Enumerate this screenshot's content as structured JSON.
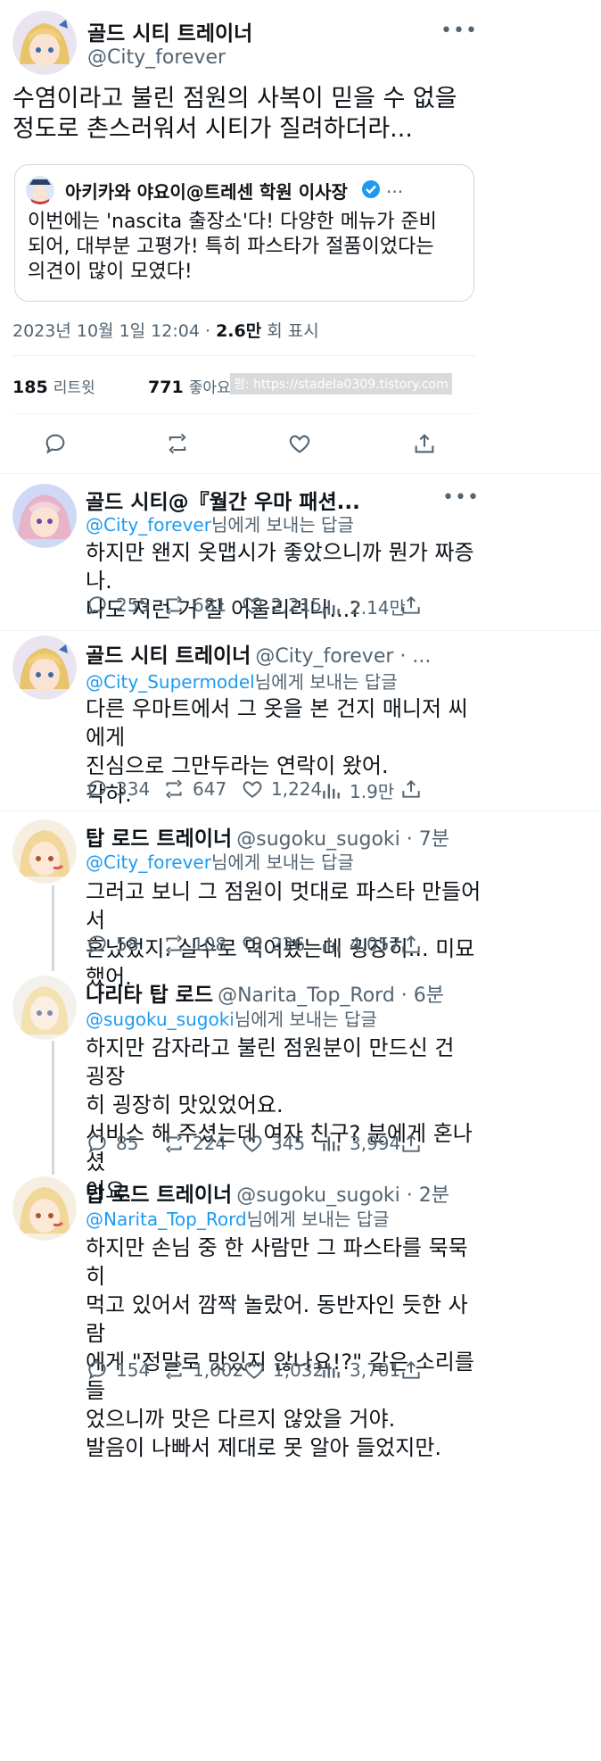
{
  "main_tweet": {
    "name": "골드 시티 트레이너",
    "handle": "@City_forever",
    "text": "수염이라고 불린 점원의 사복이 믿을 수 없을\n정도로 촌스러워서 시티가 질려하더라...",
    "quote": {
      "name": "아키카와 야요이@트레센 학원 이사장",
      "text": "이번에는 'nascita 출장소'다! 다양한 메뉴가 준비\n되어, 대부분 고평가! 특히 파스타가 절품이었다는\n의견이 많이 모였다!"
    },
    "date": "2023년 10월 1일  12:04",
    "views": "2.6만",
    "views_label": "회 표시",
    "retweets": "185",
    "retweets_label": "리트윗",
    "likes": "771",
    "likes_label": "좋아요",
    "watermark": "펌: https://stadela0309.tistory.com"
  },
  "replies": [
    {
      "name": "골드 시티@『월간 우마 패션...",
      "handle": "",
      "time": "",
      "reply_handle": "@City_forever",
      "reply_suffix": "님에게 보내는 답글",
      "text": "하지만 왠지 옷맵시가 좋았으니까 뭔가 짜증나.\n나도 저런 거 잘 어울리려나...?",
      "comments": "255",
      "retweets": "681",
      "likes": "2,215",
      "views": "2.14만"
    },
    {
      "name": "골드 시티 트레이너",
      "handle": "@City_forever · ...",
      "time": "",
      "reply_handle": "@City_Supermodel",
      "reply_suffix": "님에게 보내는 답글",
      "text": "다른 우마트에서 그 옷을 본 건지 매니저 씨에게\n진심으로 그만두라는 연락이 왔어.\n각하.",
      "comments": "334",
      "retweets": "647",
      "likes": "1,224",
      "views": "1.9만"
    },
    {
      "name": "탑 로드 트레이너",
      "handle": "@sugoku_sugoki · 7분",
      "time": "",
      "reply_handle": "@City_forever",
      "reply_suffix": "님에게 보내는 답글",
      "text": "그러고 보니 그 점원이 멋대로 파스타 만들어서\n혼났었지. 실수로 먹어봤는데 굉장히... 미묘했어.",
      "comments": "58",
      "retweets": "108",
      "likes": "226",
      "views": "4,057"
    },
    {
      "name": "나리타 탑 로드",
      "handle": "@Narita_Top_Rord · 6분",
      "time": "",
      "reply_handle": "@sugoku_sugoki",
      "reply_suffix": "님에게 보내는 답글",
      "text": "하지만 감자라고 불린 점원분이 만드신 건 굉장\n히 굉장히 맛있었어요.\n서비스 해 주셨는데 여자 친구? 분에게 혼나셨\n어요.",
      "comments": "85",
      "retweets": "224",
      "likes": "345",
      "views": "3,994"
    },
    {
      "name": "탑 로드 트레이너",
      "handle": "@sugoku_sugoki · 2분",
      "time": "",
      "reply_handle": "@Narita_Top_Rord",
      "reply_suffix": "님에게 보내는 답글",
      "text": "하지만 손님 중 한 사람만 그 파스타를 묵묵히\n먹고 있어서 깜짝 놀랐어. 동반자인 듯한 사람\n에게 \"정말로 맛있지 않나요!?\" 같은 소리를 들\n었으니까 맛은 다르지 않았을 거야.\n발음이 나빠서 제대로 못 알아 들었지만.",
      "comments": "154",
      "retweets": "1,002",
      "likes": "1,032",
      "views": "3,701"
    }
  ],
  "colors": {
    "accent": "#1d9bf0",
    "muted": "#536471",
    "divider": "#eff3f4"
  },
  "icons": [
    "reply-icon",
    "retweet-icon",
    "like-icon",
    "share-icon",
    "views-icon",
    "more-icon",
    "verified-icon"
  ]
}
